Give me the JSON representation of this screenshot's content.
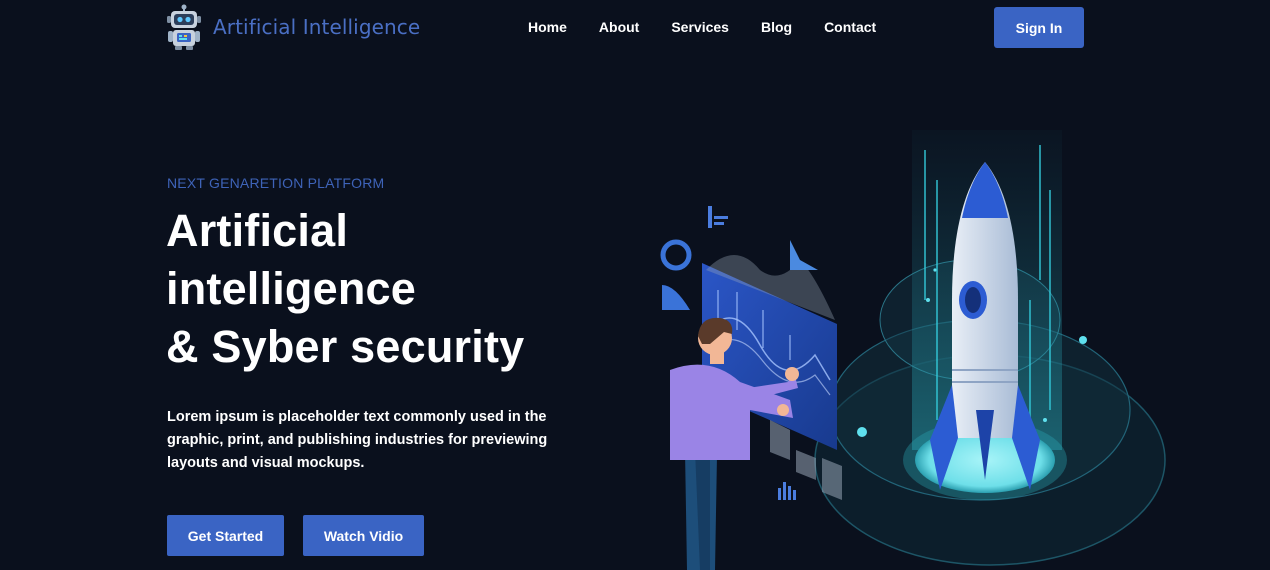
{
  "header": {
    "logo_text": "Artificial Intelligence",
    "logo_icon": "robot-icon",
    "nav": [
      {
        "label": "Home"
      },
      {
        "label": "About"
      },
      {
        "label": "Services"
      },
      {
        "label": "Blog"
      },
      {
        "label": "Contact"
      }
    ],
    "signin_label": "Sign In"
  },
  "hero": {
    "eyebrow": "NEXT GENARETION PLATFORM",
    "headline_lines": [
      "Artificial",
      "intelligence",
      "& Syber security"
    ],
    "description": "Lorem ipsum is placeholder text commonly used in the graphic, print, and publishing industries for previewing layouts and visual mockups.",
    "primary_button": "Get Started",
    "secondary_button": "Watch Vidio",
    "illustration": "rocket-analytics-illustration"
  },
  "colors": {
    "background": "#0a101d",
    "accent": "#3a64c4",
    "logo_text": "#4a6fc4",
    "eyebrow": "#3e63b8",
    "cyan_glow": "#5fe0ee"
  }
}
